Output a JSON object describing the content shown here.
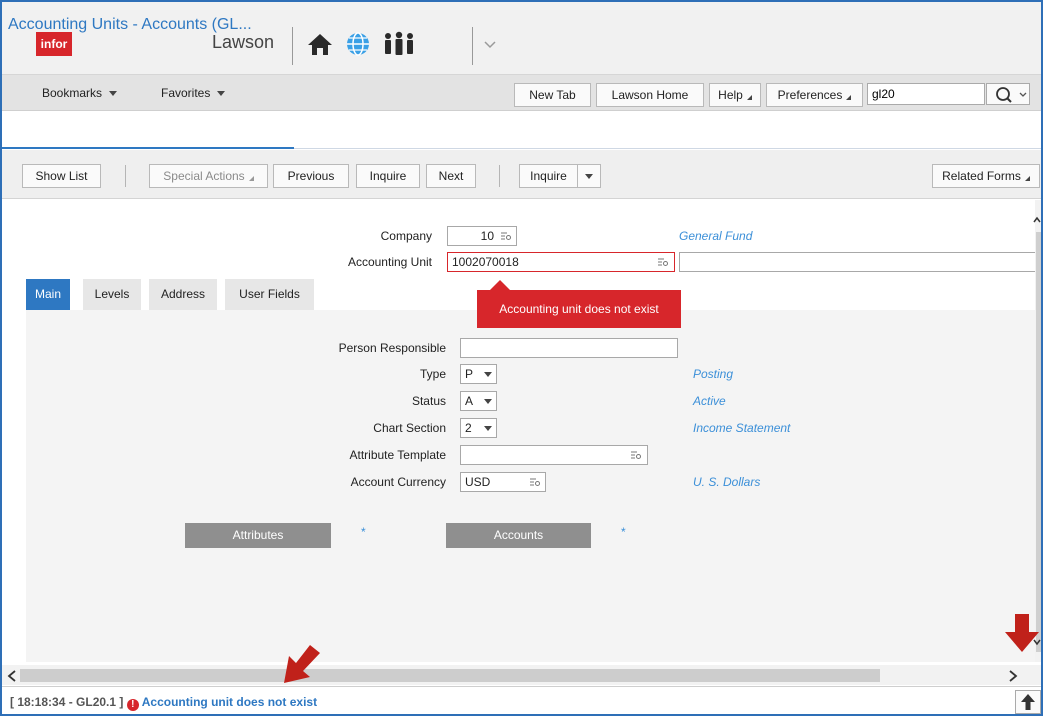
{
  "header": {
    "logo_text": "infor",
    "app_title": "Lawson",
    "icons": [
      "home-icon",
      "globe-icon",
      "people-icon",
      "chevron-down-icon"
    ]
  },
  "navbar": {
    "bookmarks": "Bookmarks",
    "favorites": "Favorites",
    "new_tab": "New Tab",
    "lawson_home": "Lawson Home",
    "help": "Help",
    "preferences": "Preferences",
    "search_value": "gl20"
  },
  "form_title": "Accounting Units - Accounts (GL...",
  "toolbar": {
    "show_list": "Show List",
    "special_actions": "Special Actions",
    "previous": "Previous",
    "inquire": "Inquire",
    "next": "Next",
    "inquire_dropdown": "Inquire",
    "related_forms": "Related Forms"
  },
  "form": {
    "company_label": "Company",
    "company_value": "10",
    "company_desc": "General Fund",
    "accounting_unit_label": "Accounting Unit",
    "accounting_unit_value": "1002070018",
    "accounting_unit_desc_value": "",
    "error_tooltip": "Accounting unit does not exist"
  },
  "tabs": [
    "Main",
    "Levels",
    "Address",
    "User Fields"
  ],
  "main_tab": {
    "person_responsible_label": "Person Responsible",
    "person_responsible_value": "",
    "type_label": "Type",
    "type_value": "P",
    "type_desc": "Posting",
    "status_label": "Status",
    "status_value": "A",
    "status_desc": "Active",
    "chart_section_label": "Chart Section",
    "chart_section_value": "2",
    "chart_section_desc": "Income Statement",
    "attribute_template_label": "Attribute Template",
    "attribute_template_value": "",
    "account_currency_label": "Account Currency",
    "account_currency_value": "USD",
    "account_currency_desc": "U. S. Dollars",
    "attributes_button": "Attributes",
    "accounts_button": "Accounts",
    "marker": "*"
  },
  "status_bar": {
    "prefix": "[ 18:18:34 - GL20.1 ]",
    "message": "Accounting unit does not exist"
  },
  "colors": {
    "brand_red": "#d7262b",
    "link_blue": "#2e78c2",
    "annotation_arrow": "#c0211a"
  }
}
